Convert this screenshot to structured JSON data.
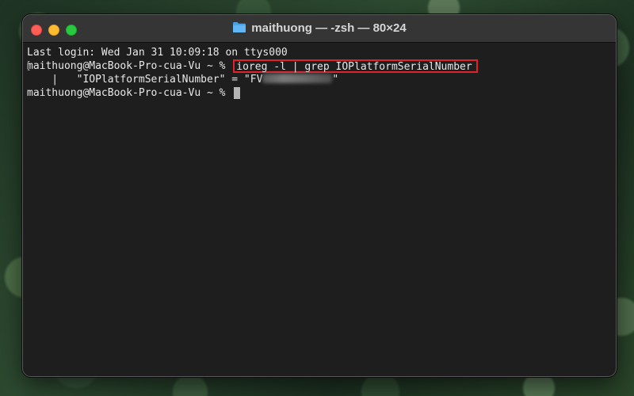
{
  "window": {
    "title": "maithuong — -zsh — 80×24"
  },
  "terminal": {
    "login_line": "Last login: Wed Jan 31 10:09:18 on ttys000",
    "prompt": "maithuong@MacBook-Pro-cua-Vu ~ % ",
    "command": "ioreg -l | grep IOPlatformSerialNumber",
    "output_line": "    |   \"IOPlatformSerialNumber\" = \"FV",
    "output_close": "\"",
    "mark_left": "[",
    "mark_right": "]"
  },
  "icons": {
    "title": "folder-icon",
    "close": "close-icon",
    "minimize": "minimize-icon",
    "maximize": "maximize-icon"
  },
  "colors": {
    "highlight_border": "#e0232a",
    "terminal_bg": "#1e1e1e",
    "close": "#ff5f57",
    "minimize": "#febc2e",
    "maximize": "#28c840",
    "folder": "#4aa3e8"
  }
}
